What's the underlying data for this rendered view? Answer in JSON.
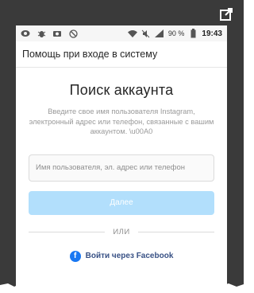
{
  "status_bar": {
    "battery_percent": "90 %",
    "time": "19:43"
  },
  "header": {
    "title": "Помощь при входе в систему"
  },
  "main": {
    "title": "Поиск аккаунта",
    "description": "Введите свое имя пользователя Instagram, электронный адрес или телефон, связанные с вашим аккаунтом. \\u00A0",
    "input": {
      "placeholder": "Имя пользователя, эл. адрес или телефон",
      "value": ""
    },
    "next_button_label": "Далее",
    "or_label": "ИЛИ",
    "facebook_login_label": "Войти через Facebook"
  },
  "colors": {
    "frame_bg": "#3a3a3a",
    "button_disabled": "#b2dffc",
    "facebook_blue": "#1877f2",
    "facebook_text": "#385185"
  },
  "icons": [
    "open-external-icon",
    "eye-icon",
    "bug-icon",
    "camera-icon",
    "no-disturb-icon",
    "wifi-icon",
    "mute-icon",
    "signal-icon",
    "battery-icon",
    "facebook-icon"
  ]
}
